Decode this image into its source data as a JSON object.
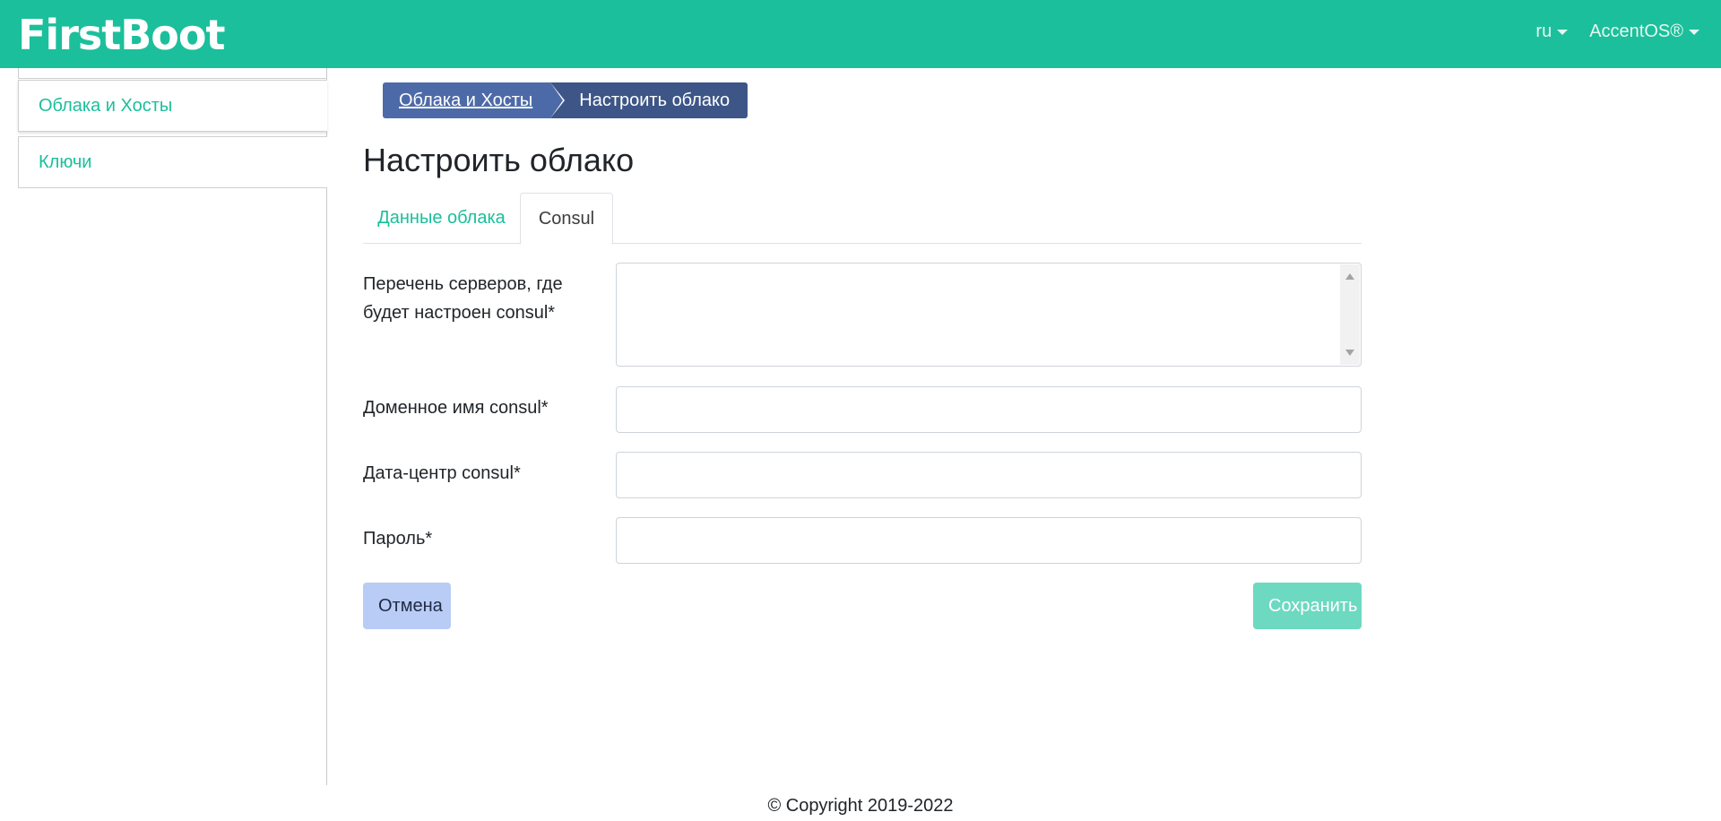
{
  "header": {
    "brand": "FirstBoot",
    "language": "ru",
    "user": "AccentOS®"
  },
  "sidebar": {
    "items": [
      {
        "label": "Облака и Хосты",
        "active": true
      },
      {
        "label": "Ключи",
        "active": false
      }
    ]
  },
  "breadcrumb": {
    "items": [
      "Облака и Хосты",
      "Настроить облако"
    ]
  },
  "page": {
    "title": "Настроить облако"
  },
  "tabs": [
    {
      "label": "Данные облака",
      "active": false
    },
    {
      "label": "Consul",
      "active": true
    }
  ],
  "form": {
    "servers_label": "Перечень серверов, где будет настроен consul*",
    "servers_value": "",
    "domain_label": "Доменное имя consul*",
    "domain_value": "",
    "datacenter_label": "Дата-центр consul*",
    "datacenter_value": "",
    "password_label": "Пароль*",
    "password_value": ""
  },
  "buttons": {
    "cancel": "Отмена",
    "save": "Сохранить"
  },
  "footer": {
    "copyright": "© Copyright 2019-2022"
  },
  "colors": {
    "accent": "#1bbf9b",
    "breadcrumb_link": "#4d6aa8",
    "breadcrumb_current": "#3d5687",
    "cancel_button": "#b8ccf5",
    "save_button": "#6dd9c1"
  }
}
